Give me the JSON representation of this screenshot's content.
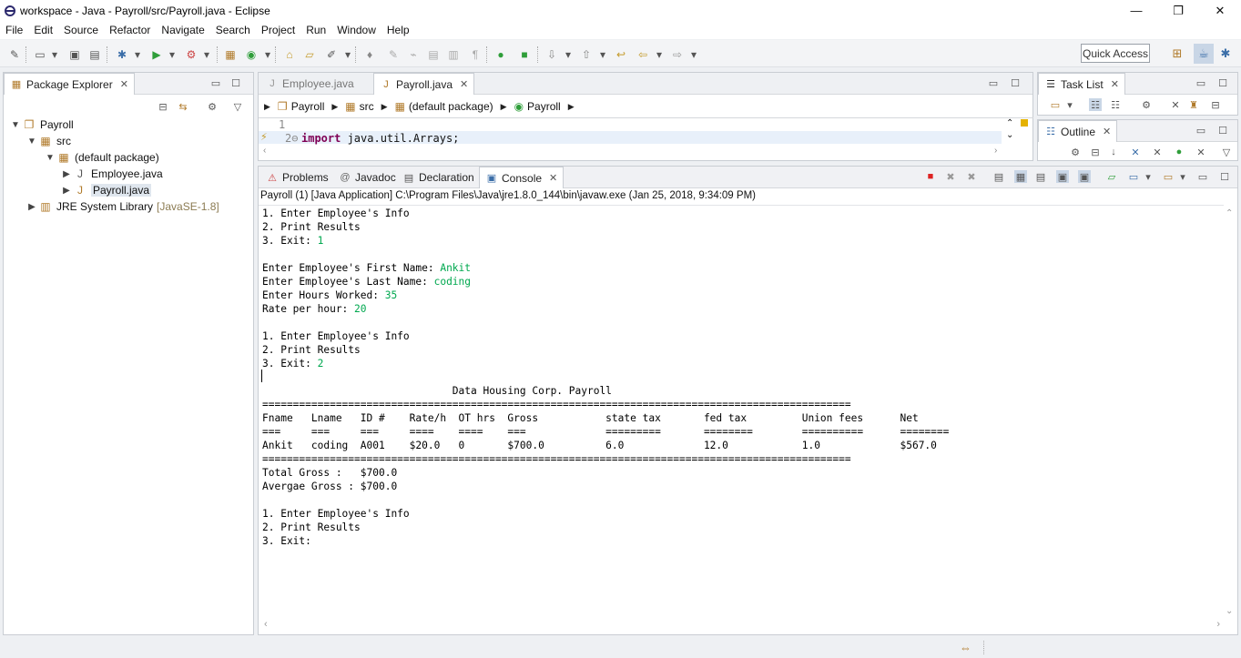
{
  "window": {
    "title": "workspace - Java - Payroll/src/Payroll.java - Eclipse",
    "controls": {
      "minimize": "—",
      "restore": "❐",
      "close": "✕"
    }
  },
  "menu": [
    "File",
    "Edit",
    "Source",
    "Refactor",
    "Navigate",
    "Search",
    "Project",
    "Run",
    "Window",
    "Help"
  ],
  "toolbar": {
    "quick_access": "Quick Access"
  },
  "package_explorer": {
    "tab_label": "Package Explorer",
    "tree": [
      {
        "label": "Payroll",
        "icon": "project-icon"
      },
      {
        "label": "src",
        "icon": "source-folder-icon"
      },
      {
        "label": "(default package)",
        "icon": "package-icon"
      },
      {
        "label": "Employee.java",
        "icon": "java-file-icon"
      },
      {
        "label": "Payroll.java",
        "icon": "java-file-icon",
        "selected": true
      },
      {
        "label": "JRE System Library",
        "icon": "library-icon",
        "decoration": "[JavaSE-1.8]"
      }
    ]
  },
  "editor": {
    "tabs": [
      {
        "label": "Employee.java",
        "active": false
      },
      {
        "label": "Payroll.java",
        "active": true
      }
    ],
    "breadcrumb": [
      "Payroll",
      "src",
      "(default package)",
      "Payroll"
    ],
    "lines": [
      {
        "number": "1",
        "text": ""
      },
      {
        "number": "2⊖",
        "keyword": "import",
        "text": " java.util.Arrays;"
      }
    ]
  },
  "task_list": {
    "tab_label": "Task List"
  },
  "outline": {
    "tab_label": "Outline"
  },
  "bottom_panel": {
    "tabs": [
      {
        "label": "Problems",
        "icon": "problems-icon"
      },
      {
        "label": "Javadoc",
        "icon": "javadoc-icon"
      },
      {
        "label": "Declaration",
        "icon": "declaration-icon"
      },
      {
        "label": "Console",
        "icon": "console-icon",
        "active": true
      }
    ],
    "console_header": "Payroll (1) [Java Application] C:\\Program Files\\Java\\jre1.8.0_144\\bin\\javaw.exe (Jan 25, 2018, 9:34:09 PM)",
    "console_lines": [
      {
        "text": "1. Enter Employee's Info"
      },
      {
        "text": "2. Print Results"
      },
      {
        "text": "3. Exit: ",
        "input": "1"
      },
      {
        "text": ""
      },
      {
        "text": "Enter Employee's First Name: ",
        "input": "Ankit"
      },
      {
        "text": "Enter Employee's Last Name: ",
        "input": "coding"
      },
      {
        "text": "Enter Hours Worked: ",
        "input": "35"
      },
      {
        "text": "Rate per hour: ",
        "input": "20"
      },
      {
        "text": ""
      },
      {
        "text": "1. Enter Employee's Info"
      },
      {
        "text": "2. Print Results"
      },
      {
        "text": "3. Exit: ",
        "input": "2"
      },
      {
        "text": ""
      },
      {
        "text": "                               Data Housing Corp. Payroll"
      },
      {
        "text": "================================================================================================"
      },
      {
        "text": "Fname   Lname   ID #    Rate/h  OT hrs  Gross           state tax       fed tax         Union fees      Net"
      },
      {
        "text": "===     ===     ===     ====    ====    ===             =========       ========        ==========      ========"
      },
      {
        "text": "Ankit   coding  A001    $20.0   0       $700.0          6.0             12.0            1.0             $567.0"
      },
      {
        "text": "================================================================================================"
      },
      {
        "text": "Total Gross :   $700.0"
      },
      {
        "text": "Avergae Gross : $700.0"
      },
      {
        "text": ""
      },
      {
        "text": "1. Enter Employee's Info"
      },
      {
        "text": "2. Print Results"
      },
      {
        "text": "3. Exit: "
      }
    ]
  }
}
